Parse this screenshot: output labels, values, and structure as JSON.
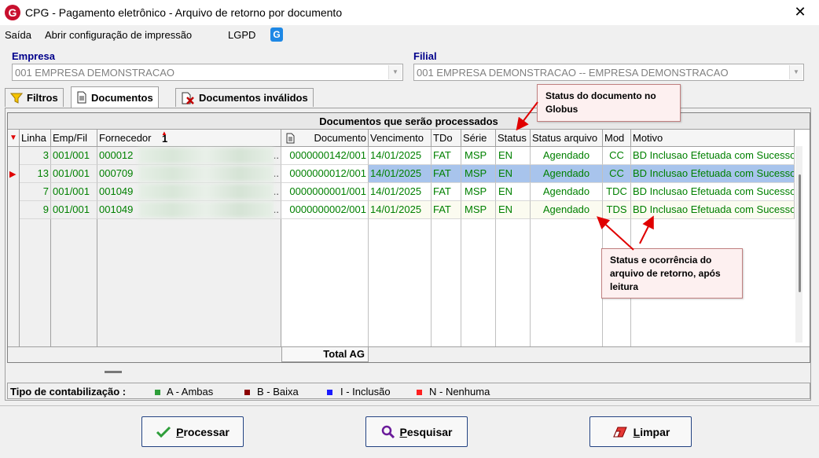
{
  "window": {
    "title": "CPG - Pagamento eletrônico - Arquivo de retorno por documento",
    "logo": "G",
    "close": "✕"
  },
  "menu": {
    "items": [
      "Saída",
      "Abrir configuração de impressão",
      "LGPD"
    ],
    "g_icon": "G"
  },
  "empresa": {
    "label": "Empresa",
    "value": "001 EMPRESA DEMONSTRACAO"
  },
  "filial": {
    "label": "Filial",
    "value": "001 EMPRESA DEMONSTRACAO -- EMPRESA DEMONSTRACAO"
  },
  "tabs": [
    {
      "label": "Filtros",
      "icon": "funnel-icon"
    },
    {
      "label": "Documentos",
      "icon": "document-icon",
      "active": true
    },
    {
      "label": "Documentos inválidos",
      "icon": "invalid-document-icon"
    }
  ],
  "grid": {
    "caption": "Documentos que serão processados",
    "sort_badge": "1",
    "columns": [
      "Linha",
      "Emp/Fil",
      "Fornecedor",
      "Documento",
      "Vencimento",
      "TDo",
      "Série",
      "Status",
      "Status arquivo",
      "Mod",
      "Motivo"
    ],
    "rows": [
      {
        "linha": "3",
        "empfil": "001/001",
        "fornecedor": "000012",
        "documento": "0000000142/001",
        "vencimento": "14/01/2025",
        "tdo": "FAT",
        "serie": "MSP",
        "status": "EN",
        "status_arquivo": "Agendado",
        "mod": "CC",
        "motivo": "BD Inclusao Efetuada com Sucesso"
      },
      {
        "linha": "13",
        "empfil": "001/001",
        "fornecedor": "000709",
        "documento": "0000000012/001",
        "vencimento": "14/01/2025",
        "tdo": "FAT",
        "serie": "MSP",
        "status": "EN",
        "status_arquivo": "Agendado",
        "mod": "CC",
        "motivo": "BD Inclusao Efetuada com Sucesso",
        "selected": true
      },
      {
        "linha": "7",
        "empfil": "001/001",
        "fornecedor": "001049",
        "documento": "0000000001/001",
        "vencimento": "14/01/2025",
        "tdo": "FAT",
        "serie": "MSP",
        "status": "EN",
        "status_arquivo": "Agendado",
        "mod": "TDC",
        "motivo": "BD Inclusao Efetuada com Sucesso"
      },
      {
        "linha": "9",
        "empfil": "001/001",
        "fornecedor": "001049",
        "documento": "0000000002/001",
        "vencimento": "14/01/2025",
        "tdo": "FAT",
        "serie": "MSP",
        "status": "EN",
        "status_arquivo": "Agendado",
        "mod": "TDS",
        "motivo": "BD Inclusao Efetuada com Sucesso"
      }
    ],
    "ellipsis": "..",
    "total_label": "Total AG"
  },
  "callouts": {
    "status_doc": "Status do documento no Globus",
    "status_arquivo": "Status e ocorrência do arquivo de retorno, após leitura"
  },
  "legend": {
    "label": "Tipo de contabilização :",
    "items": [
      {
        "text": "A - Ambas",
        "color": "#2e9e3a"
      },
      {
        "text": "B - Baixa",
        "color": "#8b0000"
      },
      {
        "text": "I - Inclusão",
        "color": "#1a1aff"
      },
      {
        "text": "N - Nenhuma",
        "color": "#ff2020"
      }
    ]
  },
  "buttons": {
    "processar": {
      "first": "P",
      "rest": "rocessar"
    },
    "pesquisar": {
      "first": "P",
      "rest": "esquisar"
    },
    "limpar": {
      "first": "L",
      "rest": "impar"
    }
  },
  "colors": {
    "row_text": "#008000",
    "selected_row": "#a8c4ec",
    "header_label": "#00008b",
    "callout_arrow": "#e00000"
  }
}
